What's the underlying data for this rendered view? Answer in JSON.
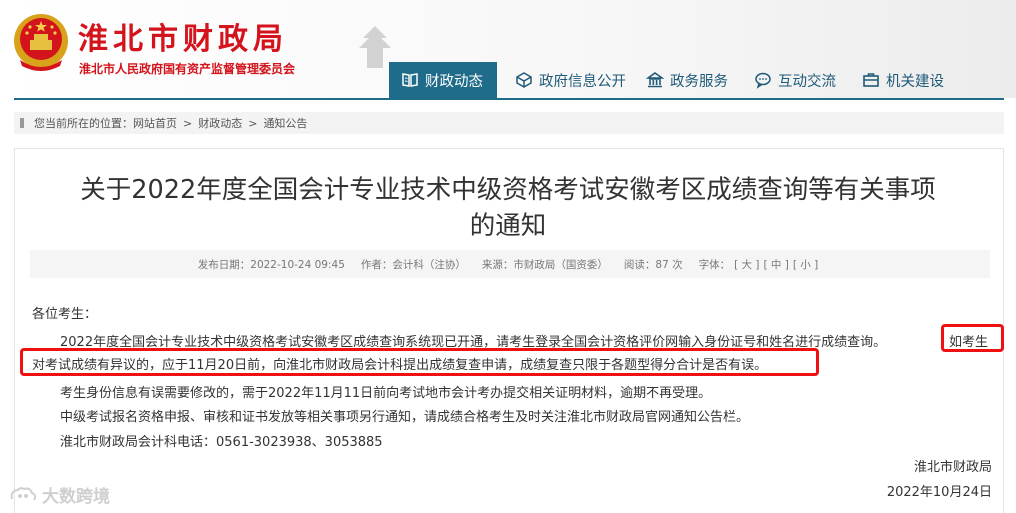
{
  "header": {
    "title": "淮北市财政局",
    "subtitle": "淮北市人民政府国有资产监督管理委员会"
  },
  "nav": {
    "items": [
      {
        "label": "财政动态",
        "icon": "book-icon",
        "active": true
      },
      {
        "label": "政府信息公开",
        "icon": "cube-icon",
        "active": false
      },
      {
        "label": "政务服务",
        "icon": "building-icon",
        "active": false
      },
      {
        "label": "互动交流",
        "icon": "chat-icon",
        "active": false
      },
      {
        "label": "机关建设",
        "icon": "briefcase-icon",
        "active": false
      }
    ]
  },
  "breadcrumb": {
    "prefix": "您当前所在的位置：",
    "items": [
      "网站首页",
      "财政动态",
      "通知公告"
    ],
    "sep": ">"
  },
  "article": {
    "title_line1": "关于2022年度全国会计专业技术中级资格考试安徽考区成绩查询等有关事项",
    "title_line2": "的通知",
    "meta": {
      "date": "发布日期：2022-10-24 09:45",
      "author": "作者：会计科（注协）",
      "source": "来源：市财政局（国资委）",
      "views": "阅读：87 次",
      "font_label": "字体：",
      "font_large": "[ 大 ]",
      "font_medium": "[ 中 ]",
      "font_small": "[ 小 ]"
    },
    "greeting": "各位考生：",
    "para1_a": "2022年度全国会计专业技术中级资格考试安徽考区成绩查询系统现已开通，请考生登录全国会计资格评价网输入身份证号和姓名进行成绩查询。",
    "para1_b": "如考生",
    "para1_c": "对考试成绩有异议的，应于11月20日前，向淮北市财政局会计科提出成绩复查申请，成绩复查只限于各题型得分合计是否有误。",
    "para2": "考生身份信息有误需要修改的，需于2022年11月11日前向考试地市会计考办提交相关证明材料，逾期不再受理。",
    "para3": "中级考试报名资格申报、审核和证书发放等相关事项另行通知，请成绩合格考生及时关注淮北市财政局官网通知公告栏。",
    "para4": "淮北市财政局会计科电话：0561-3023938、3053885",
    "sign_org": "淮北市财政局",
    "sign_date": "2022年10月24日"
  },
  "watermark": "大数跨境",
  "colors": {
    "brand_red": "#d4141c",
    "nav_teal": "#1f6b8a",
    "highlight_red": "#e11111"
  }
}
